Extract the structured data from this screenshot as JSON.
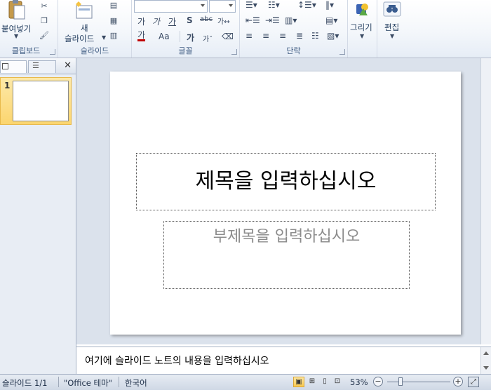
{
  "ribbon": {
    "groups": {
      "clipboard": {
        "label": "클립보드",
        "paste_label": "붙여넣기"
      },
      "slides": {
        "label": "슬라이드",
        "new_label_1": "새",
        "new_label_2": "슬라이드"
      },
      "font": {
        "label": "글꼴"
      },
      "paragraph": {
        "label": "단락"
      },
      "drawing": {
        "label": "그리기"
      },
      "editing": {
        "label": "편집"
      }
    },
    "font_glyphs": {
      "grow": "가",
      "shrink": "가",
      "underline": "가",
      "strike": "S",
      "spacing": "ᵃᵇᶜ",
      "change_case": "Aa",
      "clear": "가",
      "superscript": "가"
    }
  },
  "left_pane": {
    "slide_number": "1"
  },
  "slide": {
    "title_placeholder": "제목을 입력하십시오",
    "subtitle_placeholder": "부제목을 입력하십시오"
  },
  "notes": {
    "placeholder": "여기에 슬라이드 노트의 내용을 입력하십시오"
  },
  "status": {
    "slide_counter": "슬라이드 1/1",
    "theme": "\"Office 테마\"",
    "language": "한국어",
    "zoom": "53%"
  }
}
